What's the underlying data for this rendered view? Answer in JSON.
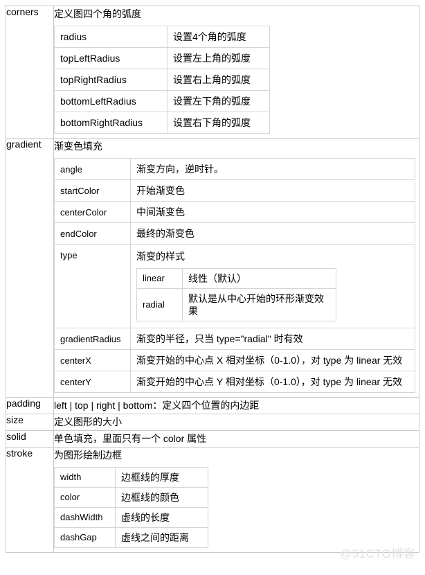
{
  "table": {
    "rows": [
      {
        "key": "corners",
        "desc": "定义图四个角的弧度",
        "sub": {
          "kind": "corners",
          "rows": [
            {
              "name": "radius",
              "desc": "设置4个角的弧度"
            },
            {
              "name": "topLeftRadius",
              "desc": "设置左上角的弧度"
            },
            {
              "name": "topRightRadius",
              "desc": "设置右上角的弧度"
            },
            {
              "name": "bottomLeftRadius",
              "desc": "设置左下角的弧度"
            },
            {
              "name": "bottomRightRadius",
              "desc": "设置右下角的弧度"
            }
          ]
        }
      },
      {
        "key": "gradient",
        "desc": "渐变色填充",
        "sub": {
          "kind": "gradient",
          "rows": [
            {
              "name": "angle",
              "desc": "渐变方向，逆时针。"
            },
            {
              "name": "startColor",
              "desc": "开始渐变色"
            },
            {
              "name": "centerColor",
              "desc": "中间渐变色"
            },
            {
              "name": "endColor",
              "desc": "最终的渐变色"
            },
            {
              "name": "type",
              "desc": "渐变的样式",
              "sub": {
                "kind": "type",
                "rows": [
                  {
                    "name": "linear",
                    "desc": "线性（默认）"
                  },
                  {
                    "name": "radial",
                    "desc": "默认是从中心开始的环形渐变效果"
                  }
                ]
              }
            },
            {
              "name": "gradientRadius",
              "desc": "渐变的半径，只当 type=\"radial\" 时有效"
            },
            {
              "name": "centerX",
              "desc": "渐变开始的中心点 X 相对坐标（0-1.0），对 type 为 linear 无效"
            },
            {
              "name": "centerY",
              "desc": "渐变开始的中心点 Y 相对坐标（0-1.0），对 type 为 linear 无效"
            }
          ]
        }
      },
      {
        "key": "padding",
        "desc": "left | top | right | bottom：定义四个位置的内边距"
      },
      {
        "key": "size",
        "desc": "定义图形的大小"
      },
      {
        "key": "solid",
        "desc": "单色填充，里面只有一个 color 属性"
      },
      {
        "key": "stroke",
        "desc": "为图形绘制边框",
        "sub": {
          "kind": "stroke",
          "rows": [
            {
              "name": "width",
              "desc": "边框线的厚度"
            },
            {
              "name": "color",
              "desc": "边框线的颜色"
            },
            {
              "name": "dashWidth",
              "desc": "虚线的长度"
            },
            {
              "name": "dashGap",
              "desc": "虚线之间的距离"
            }
          ]
        }
      }
    ]
  },
  "watermark": "@51CTO博客",
  "colors": {
    "border_outer": "#c9c9c9",
    "border_inner": "#d5d5d5",
    "text": "#000000",
    "watermark": "#e2e2e2"
  }
}
